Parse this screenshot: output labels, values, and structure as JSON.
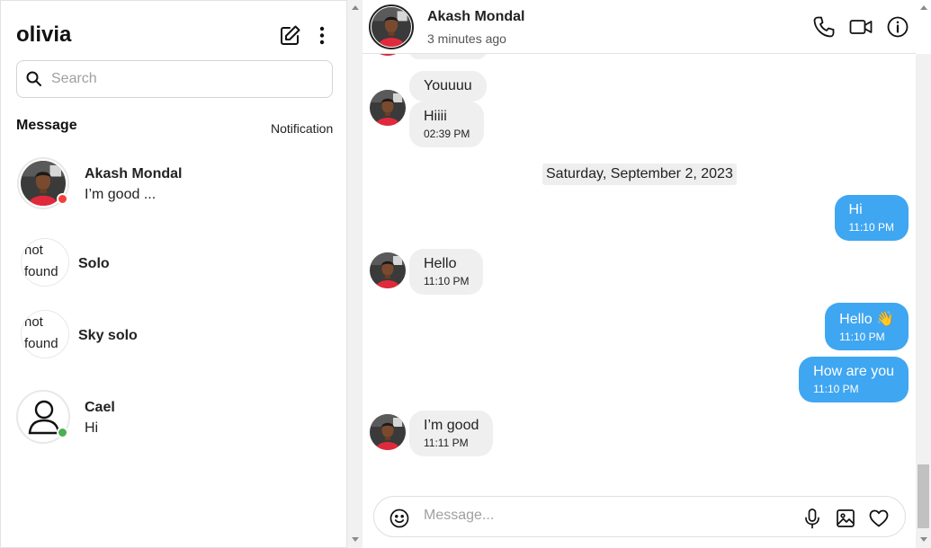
{
  "sidebar": {
    "username": "olivia",
    "search_placeholder": "Search",
    "section_message": "Message",
    "section_notification": "Notification",
    "conversations": [
      {
        "name": "Akash Mondal",
        "preview": "I’m good ...",
        "avatar": "photo",
        "status_color": "#f2413a"
      },
      {
        "name": "Solo",
        "preview": "",
        "avatar": "broken",
        "broken_alt": "not found"
      },
      {
        "name": "Sky solo",
        "preview": "",
        "avatar": "broken",
        "broken_alt": "not found"
      },
      {
        "name": "Cael",
        "preview": "Hi",
        "avatar": "user-icon",
        "status_color": "#4caf50"
      }
    ]
  },
  "chat": {
    "contact_name": "Akash Mondal",
    "contact_status": "3 minutes ago",
    "date_separator": "Saturday, September 2, 2023",
    "messages": [
      {
        "dir": "in",
        "text": "Youuuu",
        "time": ""
      },
      {
        "dir": "in",
        "text": "Hiiii",
        "time": "02:39 PM"
      },
      {
        "dir": "out",
        "text": "Hi",
        "time": "11:10 PM"
      },
      {
        "dir": "in",
        "text": "Hello",
        "time": "11:10 PM"
      },
      {
        "dir": "out",
        "text": "Hello 👋",
        "time": "11:10 PM"
      },
      {
        "dir": "out",
        "text": "How are you",
        "time": "11:10 PM"
      },
      {
        "dir": "in",
        "text": "I’m good",
        "time": "11:11 PM"
      }
    ],
    "composer_placeholder": "Message..."
  },
  "icons": {
    "compose": "edit-square-icon",
    "menu": "more-vertical-icon",
    "search": "search-icon",
    "call": "phone-icon",
    "video": "video-camera-icon",
    "info": "info-icon",
    "emoji": "smiley-icon",
    "mic": "microphone-icon",
    "image": "image-icon",
    "like": "heart-icon"
  },
  "colors": {
    "outgoing_bubble": "#3fa6f1",
    "incoming_bubble": "#efefef",
    "online_dot": "#4caf50",
    "busy_dot": "#f2413a"
  }
}
